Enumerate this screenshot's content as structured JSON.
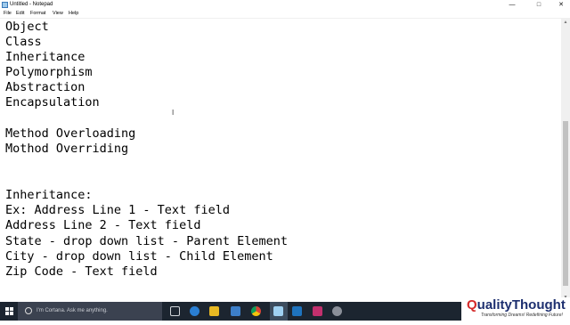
{
  "window": {
    "title": "Untitled - Notepad",
    "controls": {
      "minimize": "—",
      "maximize": "□",
      "close": "✕"
    }
  },
  "menu": [
    "File",
    "Edit",
    "Format",
    "View",
    "Help"
  ],
  "editor": {
    "lines": [
      "Object",
      "Class",
      "Inheritance",
      "Polymorphism",
      "Abstraction",
      "Encapsulation",
      "",
      "Method Overloading",
      "Mothod Overriding",
      "",
      "",
      "Inheritance:",
      "Ex: Address Line 1 - Text field",
      "Address Line 2 - Text field",
      "State - drop down list - Parent Element",
      "City - drop down list - Child Element",
      "Zip Code - Text field"
    ]
  },
  "taskbar": {
    "search_placeholder": "I'm Cortana. Ask me anything.",
    "icons": [
      "task-view-icon",
      "edge-icon",
      "file-explorer-icon",
      "store-icon",
      "chrome-icon",
      "notepad-icon",
      "app-blue-icon",
      "app-pink-icon",
      "app-gear-icon"
    ]
  },
  "branding": {
    "logo_q": "Q",
    "logo_rest": "ualityThought",
    "tagline": "Transforming Dreams! Redefining Future!"
  },
  "colors": {
    "taskbar_bg": "#1c2530",
    "search_bg": "#3b4250",
    "logo_red": "#d42a2a",
    "logo_navy": "#1d2f6f"
  }
}
